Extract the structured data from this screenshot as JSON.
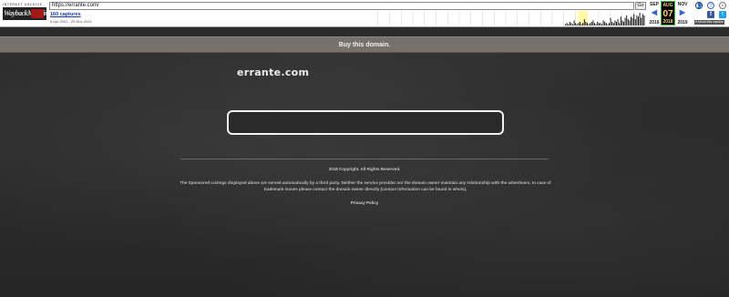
{
  "wayback": {
    "logo_top_text": "INTERNET ARCHIVE",
    "logo_main_text": "WaybackMachine",
    "url": "https://errante.com/",
    "go_label": "Go",
    "captures_label": "160 captures",
    "date_range": "6 Apr 2001 - 25 Nov 2024",
    "prev": {
      "month": "SEP",
      "year": "2016",
      "arrow": "◀"
    },
    "current": {
      "month": "AUG",
      "day": "07",
      "year": "2018"
    },
    "next": {
      "month": "NOV",
      "year": "2019",
      "arrow": "▶"
    },
    "icons": {
      "user": "user-icon",
      "help": "help-icon",
      "close": "close-icon",
      "facebook": "facebook-icon",
      "twitter": "twitter-icon"
    },
    "about_label": "▾ About this capture",
    "spark_bars": [
      1,
      2,
      1,
      3,
      2,
      1,
      4,
      2,
      1,
      2,
      3,
      1,
      2,
      5,
      3,
      2,
      1,
      2,
      3,
      4,
      2,
      1,
      3,
      2,
      2,
      1,
      4,
      3,
      2,
      1,
      2,
      6,
      3,
      2,
      4,
      3,
      5,
      2,
      7,
      4,
      3,
      6,
      8,
      5,
      4,
      7,
      6,
      9,
      5,
      8,
      7,
      10,
      6,
      9,
      8
    ],
    "colors": {
      "accent": "#3a66c4",
      "highlight": "#ffd76a",
      "current_border": "#3cbf3c"
    }
  },
  "page": {
    "banner": "Buy this domain.",
    "domain": "errante.com",
    "search_value": "",
    "copyright": "2018 Copyright. All Rights Reserved.",
    "disclaimer": "The Sponsored Listings displayed above are served automatically by a third party. Neither the service provider nor the domain owner maintain any relationship with the advertisers. In case of trademark issues please contact the domain owner directly (contact information can be found in whois).",
    "privacy": "Privacy Policy"
  }
}
